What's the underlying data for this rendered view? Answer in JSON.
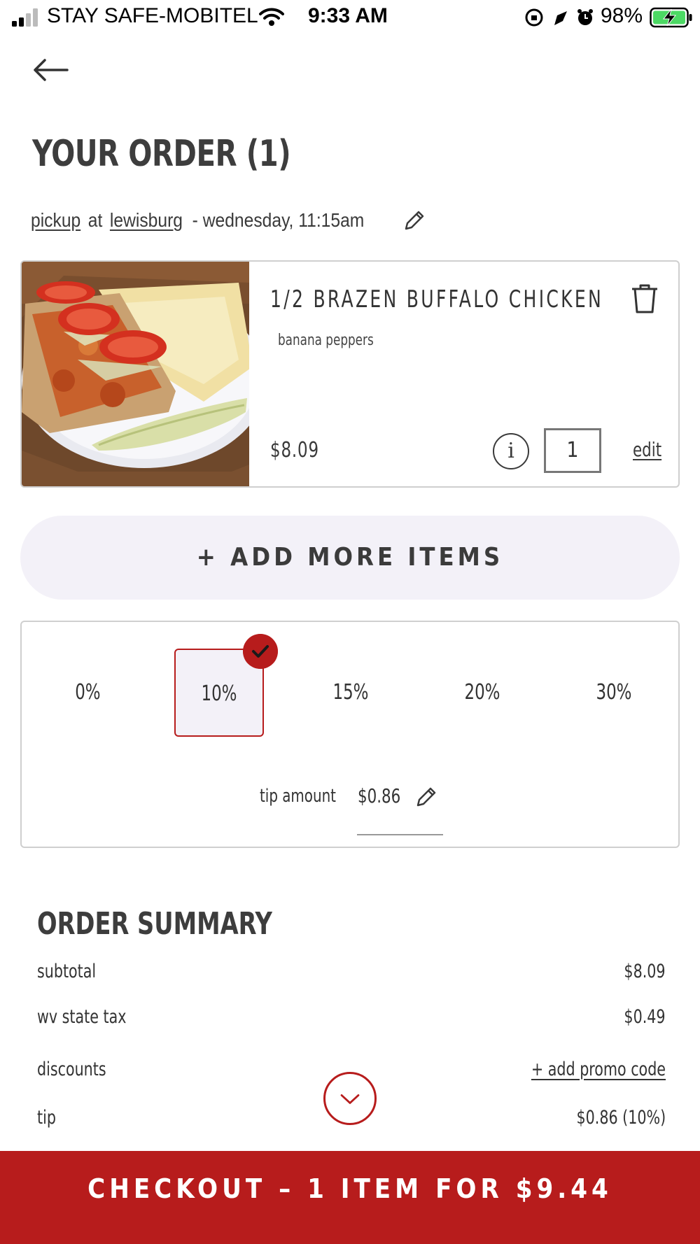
{
  "status_bar": {
    "carrier": "STAY SAFE-MOBITEL",
    "time": "9:33 AM",
    "battery": "98%"
  },
  "header": {
    "back_icon": "arrow-left-icon",
    "title": "YOUR ORDER (1)"
  },
  "order_info": {
    "method": "pickup",
    "at": "at",
    "location": "lewisburg",
    "when": "- wednesday, 11:15am",
    "edit_icon": "pencil-icon"
  },
  "item": {
    "name": "1/2  BRAZEN BUFFALO CHICKEN",
    "modifier": "banana peppers",
    "price": "$8.09",
    "info": "i",
    "quantity": "1",
    "edit_label": "edit"
  },
  "add_more_label": "+ ADD MORE ITEMS",
  "tip": {
    "options": [
      "0%",
      "10%",
      "15%",
      "20%",
      "30%"
    ],
    "selected": "10%",
    "amount_label": "tip amount",
    "amount_value": "$0.86"
  },
  "summary": {
    "title": "ORDER SUMMARY",
    "subtotal_label": "subtotal",
    "subtotal_value": "$8.09",
    "tax_label": "wv state tax",
    "tax_value": "$0.49",
    "discounts_label": "discounts",
    "promo_label": "+ add promo code",
    "tip_label": "tip",
    "tip_value": "$0.86 (10%)"
  },
  "checkout_label": "CHECKOUT – 1 ITEM FOR $9.44",
  "colors": {
    "accent": "#b71c1c",
    "soft_bg": "#f3f1f8",
    "text": "#3a3a3a"
  }
}
